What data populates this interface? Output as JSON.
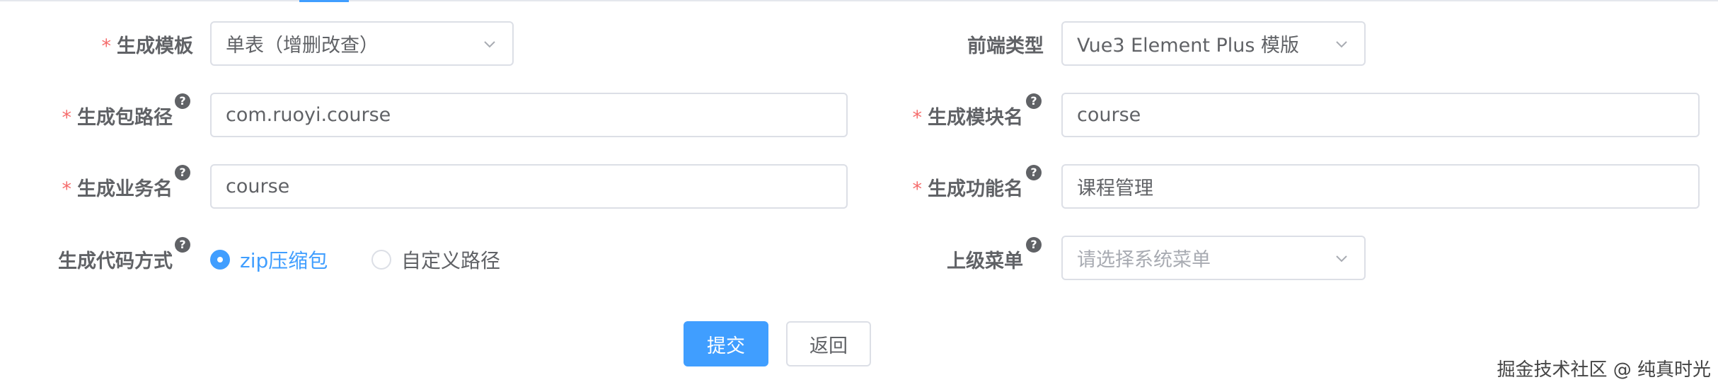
{
  "form": {
    "template": {
      "label": "生成模板",
      "required": true,
      "value": "单表（增删改查）"
    },
    "frontend_type": {
      "label": "前端类型",
      "required": false,
      "value": "Vue3 Element Plus 模版"
    },
    "package_path": {
      "label": "生成包路径",
      "required": true,
      "value": "com.ruoyi.course"
    },
    "module_name": {
      "label": "生成模块名",
      "required": true,
      "value": "course"
    },
    "business_name": {
      "label": "生成业务名",
      "required": true,
      "value": "course"
    },
    "function_name": {
      "label": "生成功能名",
      "required": true,
      "value": "课程管理"
    },
    "gen_type": {
      "label": "生成代码方式",
      "options": [
        {
          "label": "zip压缩包",
          "checked": true
        },
        {
          "label": "自定义路径",
          "checked": false
        }
      ]
    },
    "parent_menu": {
      "label": "上级菜单",
      "placeholder": "请选择系统菜单"
    },
    "required_mark": "*",
    "help_mark": "?"
  },
  "actions": {
    "submit": "提交",
    "back": "返回"
  },
  "watermark": "掘金技术社区 @ 纯真时光",
  "icons": {
    "select": "chevron-down-icon",
    "help": "question-circle-icon"
  },
  "colors": {
    "primary": "#409eff",
    "required": "#f56c6c",
    "text": "#606266",
    "placeholder": "#a8abb2",
    "border": "#dcdfe6"
  }
}
